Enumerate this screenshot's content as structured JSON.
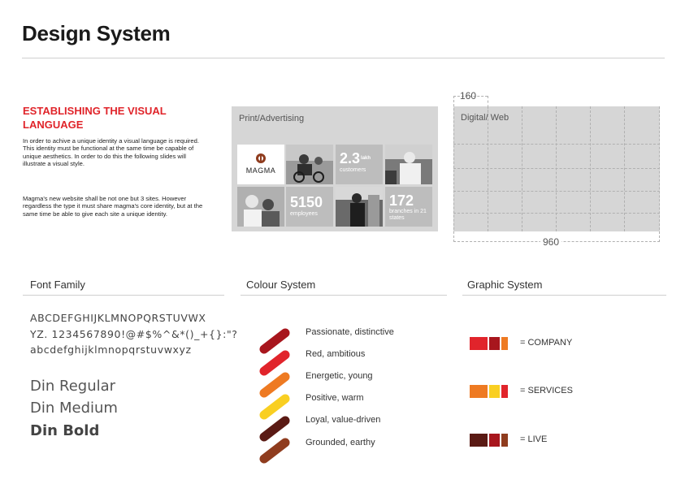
{
  "page_title": "Design System",
  "intro": {
    "heading": "ESTABLISHING THE VISUAL LANGUAGE",
    "paragraph1": "In order to achive a unique identity a visual language is required. This identity must be functional at the same time be capable of unique aesthetics. In order to do this the following slides will illustrate a visual style.",
    "paragraph2": "Magma's new website shall be not one but 3 sites. However regardless the type it must share magma's core identity, but at the same time be able to give each site a unique identity."
  },
  "print_panel": {
    "label": "Print/Advertising",
    "logo_text": "MAGMA",
    "stats": [
      {
        "value": "2.3",
        "unit": "lakh",
        "caption": "customers"
      },
      {
        "value": "5150",
        "caption": "employees"
      },
      {
        "value": "172",
        "caption": "branches in 21 states"
      }
    ]
  },
  "web_panel": {
    "label": "Digital/ Web",
    "column_width_label": "160",
    "total_width_label": "960"
  },
  "font_family": {
    "heading": "Font Family",
    "glyph_line1": "ABCDEFGHIJKLMNOPQRSTUVWX",
    "glyph_line2": "YZ. 1234567890!@#$%^&*()_+{}:\"?",
    "glyph_line3": "abcdefghijklmnopqrstuvwxyz",
    "weights": [
      "Din Regular",
      "Din Medium",
      "Din Bold"
    ]
  },
  "colour_system": {
    "heading": "Colour System",
    "swatches": [
      {
        "label": "Passionate, distinctive",
        "color": "#a8161d"
      },
      {
        "label": "Red, ambitious",
        "color": "#e1242b"
      },
      {
        "label": "Energetic, young",
        "color": "#ee7a22"
      },
      {
        "label": "Positive, warm",
        "color": "#f9cf22"
      },
      {
        "label": "Loyal, value-driven",
        "color": "#5a1a14"
      },
      {
        "label": "Grounded, earthy",
        "color": "#8f3c1e"
      }
    ]
  },
  "graphic_system": {
    "heading": "Graphic System",
    "rows": [
      {
        "label": "= COMPANY",
        "colors": [
          "#e1242b",
          "#a8161d",
          "#ee7a22"
        ]
      },
      {
        "label": "= SERVICES",
        "colors": [
          "#ee7a22",
          "#f9cf22",
          "#e1242b"
        ]
      },
      {
        "label": "= LIVE",
        "colors": [
          "#5a1a14",
          "#a8161d",
          "#8f3c1e"
        ]
      }
    ]
  }
}
